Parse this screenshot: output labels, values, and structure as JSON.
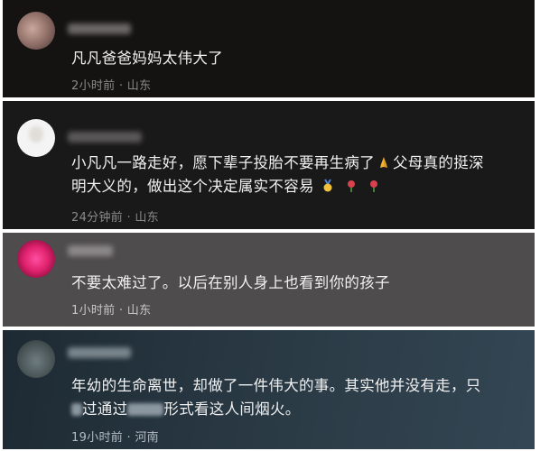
{
  "comments": [
    {
      "text": "凡凡爸爸妈妈太伟大了",
      "time": "2小时前",
      "location": "山东"
    },
    {
      "text_line1": "小凡凡一路走好，愿下辈子投胎不要再生病了",
      "text_line1_tail": "父母真的挺深",
      "text_line2": "明大义的，做出这个决定属实不容易",
      "time": "24分钟前",
      "location": "山东",
      "icons": [
        "pray-emoji",
        "gold-medal-emoji",
        "rose-emoji",
        "rose-emoji"
      ]
    },
    {
      "text": "不要太难过了。以后在别人身上也看到你的孩子",
      "time": "1小时前",
      "location": "山东"
    },
    {
      "text_line1": "年幼的生命离世，却做了一件伟大的事。其实他并没有走，只",
      "text_line2_a": "过通过",
      "text_line2_b": "形式看这人间烟火。",
      "time": "19小时前",
      "location": "河南"
    }
  ],
  "meta_separator": "·"
}
